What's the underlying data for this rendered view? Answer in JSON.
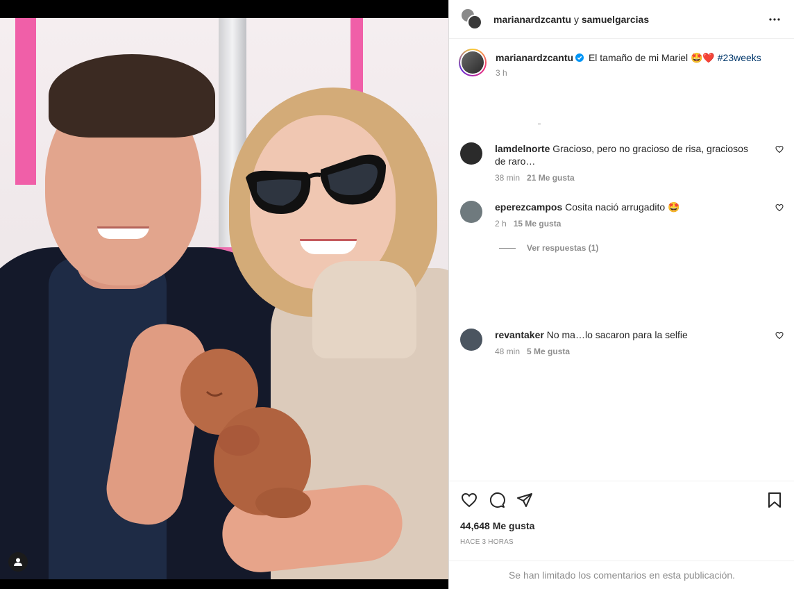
{
  "post": {
    "header": {
      "user1": "marianardzcantu",
      "separator": "y",
      "user2": "samuelgarcias"
    },
    "caption": {
      "username": "marianardzcantu",
      "text": "El tamaño de mi Mariel 🤩❤️",
      "hashtag": "#23weeks",
      "time": "3 h"
    },
    "comments": [
      {
        "username": "lamdelnorte",
        "text": "Gracioso, pero no gracioso de risa, graciosos de raro…",
        "time": "38 min",
        "likes": "21 Me gusta",
        "avatar_color": "#2b2b2b"
      },
      {
        "username": "eperezcampos",
        "text": "Cosita nació arrugadito 🤩",
        "time": "2 h",
        "likes": "15 Me gusta",
        "avatar_color": "#6f7a7e"
      },
      {
        "username": "revantaker",
        "text": "No ma…lo sacaron para la selfie",
        "time": "48 min",
        "likes": "5 Me gusta",
        "avatar_color": "#4b5560"
      }
    ],
    "view_replies": "Ver respuestas (1)",
    "likes_count": "44,648 Me gusta",
    "posted_ago": "HACE 3 HORAS",
    "comments_limited": "Se han limitado los comentarios en esta publicación."
  },
  "icons": {
    "more": "more-options-icon",
    "heart": "heart-icon",
    "comment": "comment-icon",
    "share": "share-icon",
    "save": "bookmark-icon",
    "verified": "verified-badge-icon",
    "user_tag": "user-tag-icon"
  },
  "colors": {
    "verified": "#0095f6",
    "hashtag": "#00376b",
    "secondary_text": "#8e8e8e",
    "primary_text": "#262626"
  }
}
